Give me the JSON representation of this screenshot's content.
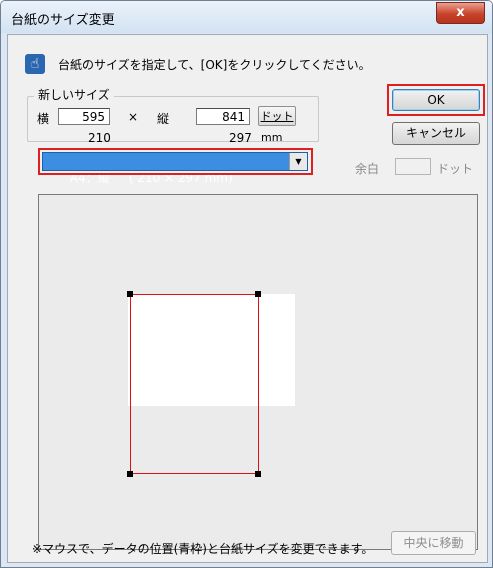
{
  "window": {
    "title": "台紙のサイズ変更",
    "close_label": "x"
  },
  "instruction": {
    "icon": "pointing-hand-icon",
    "text": "台紙のサイズを指定して、[OK]をクリックしてください。"
  },
  "new_size": {
    "group_label": "新しいサイズ",
    "width_label": "横",
    "width_value": "595",
    "times_sign": "×",
    "height_label": "縦",
    "height_value": "841",
    "unit_button_label": "ドット",
    "width_mm": "210",
    "height_mm": "297",
    "mm_unit": "mm",
    "paper_select_value": "A4：縦     ( 210 × 297 mm)"
  },
  "buttons": {
    "ok_label": "OK",
    "cancel_label": "キャンセル",
    "center_label": "中央に移動"
  },
  "margin": {
    "label": "余白",
    "value": "",
    "unit": "ドット"
  },
  "footer_note": "※マウスで、データの位置(青枠)と台紙サイズを変更できます。",
  "colors": {
    "highlight_red": "#e02020",
    "paper_frame": "#dd1111",
    "selection_blue": "#3b8ee0"
  }
}
